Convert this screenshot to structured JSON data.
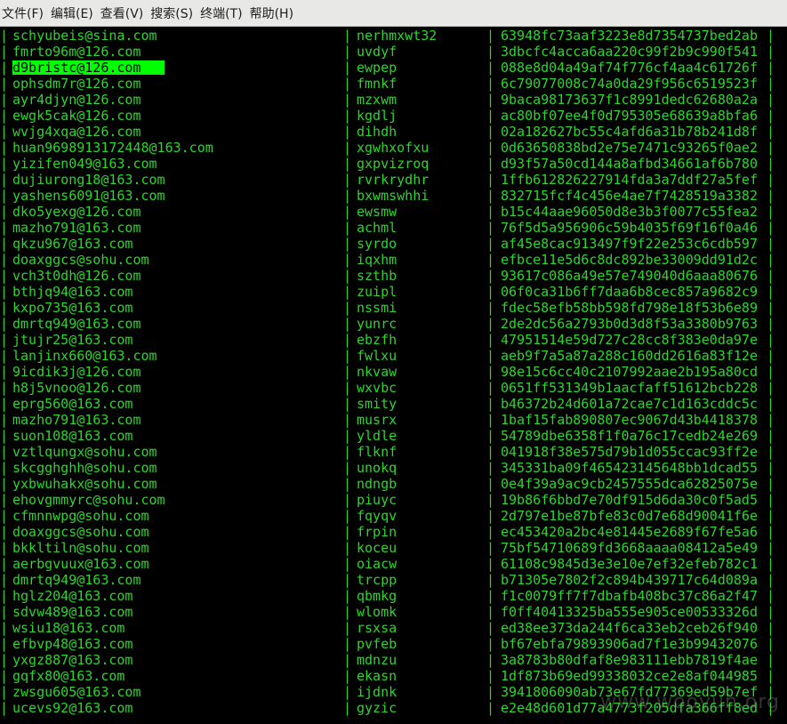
{
  "menubar": {
    "items": [
      "文件(F)",
      "编辑(E)",
      "查看(V)",
      "搜索(S)",
      "终端(T)",
      "帮助(H)"
    ]
  },
  "terminal": {
    "separator": "|",
    "selected_row_index": 2,
    "text_color": "#2ed52e",
    "highlight_color": "#00ff00",
    "rows": [
      {
        "email": "schyubeis@sina.com",
        "username": "nerhmxwt32",
        "hash": "63948fc73aaf3223e8d7354737bed2ab"
      },
      {
        "email": "fmrto96m@126.com",
        "username": "uvdyf",
        "hash": "3dbcfc4acca6aa220c99f2b9c990f541"
      },
      {
        "email": "d9bristc@126.com",
        "username": "ewpep",
        "hash": "088e8d04a49af74f776cf4aa4c61726f"
      },
      {
        "email": "ophsdm7r@126.com",
        "username": "fmnkf",
        "hash": "6c79077008c74a0da29f956c6519523f"
      },
      {
        "email": "ayr4djyn@126.com",
        "username": "mzxwm",
        "hash": "9baca98173637f1c8991dedc62680a2a"
      },
      {
        "email": "ewgk5cak@126.com",
        "username": "kgdlj",
        "hash": "ac80bf07ee4f0d795305e68639a8bfa6"
      },
      {
        "email": "wvjg4xqa@126.com",
        "username": "dihdh",
        "hash": "02a182627bc55c4afd6a31b78b241d8f"
      },
      {
        "email": "huan9698913172448@163.com",
        "username": "xgwhxofxu",
        "hash": "0d63650838bd2e75e7471c93265f0ae2"
      },
      {
        "email": "yizifen049@163.com",
        "username": "gxpvizroq",
        "hash": "d93f57a50cd144a8afbd34661af6b780"
      },
      {
        "email": "dujiurong18@163.com",
        "username": "rvrkrydhr",
        "hash": "1ffb612826227914fda3a7ddf27a5fef"
      },
      {
        "email": "yashens6091@163.com",
        "username": "bxwmswhhi",
        "hash": "832715fcf4c456e4ae7f7428519a3382"
      },
      {
        "email": "dko5yexg@126.com",
        "username": "ewsmw",
        "hash": "b15c44aae96050d8e3b3f0077c55fea2"
      },
      {
        "email": "mazho791@163.com",
        "username": "achml",
        "hash": "76f5d5a956906c59b4035f69f16f0a46"
      },
      {
        "email": "qkzu967@163.com",
        "username": "syrdo",
        "hash": "af45e8cac913497f9f22e253c6cdb597"
      },
      {
        "email": "doaxggcs@sohu.com",
        "username": "iqxhm",
        "hash": "efbce11e5d6c8dc892be33009dd91d2c"
      },
      {
        "email": "vch3t0dh@126.com",
        "username": "szthb",
        "hash": "93617c086a49e57e749040d6aaa80676"
      },
      {
        "email": "bthjq94@163.com",
        "username": "zuipl",
        "hash": "06f0ca31b6ff7daa6b8cec857a9682c9"
      },
      {
        "email": "kxpo735@163.com",
        "username": "nssmi",
        "hash": "fdec58efb58bb598fd798e18f53b6e89"
      },
      {
        "email": "dmrtq949@163.com",
        "username": "yunrc",
        "hash": "2de2dc56a2793b0d3d8f53a3380b9763"
      },
      {
        "email": "jtujr25@163.com",
        "username": "ebzfh",
        "hash": "47951514e59d727c28cc8f383e0da97e"
      },
      {
        "email": "lanjinx660@163.com",
        "username": "fwlxu",
        "hash": "aeb9f7a5a87a288c160dd2616a83f12e"
      },
      {
        "email": "9icdik3j@126.com",
        "username": "nkvaw",
        "hash": "98e15c6cc40c2107992aae2b195a80cd"
      },
      {
        "email": "h8j5vnoo@126.com",
        "username": "wxvbc",
        "hash": "0651ff531349b1aacfaff51612bcb228"
      },
      {
        "email": "eprg560@163.com",
        "username": "smity",
        "hash": "b46372b24d601a72cae7c1d163cddc5c"
      },
      {
        "email": "mazho791@163.com",
        "username": "musrx",
        "hash": "1baf15fab890807ec9067d43b4418378"
      },
      {
        "email": "suon108@163.com",
        "username": "yldle",
        "hash": "54789dbe6358f1f0a76c17cedb24e269"
      },
      {
        "email": "vztlqungx@sohu.com",
        "username": "flknf",
        "hash": "041918f38e575d79b1d055ccac93ff2e"
      },
      {
        "email": "skcgghghh@sohu.com",
        "username": "unokq",
        "hash": "345331ba09f465423145648bb1dcad55"
      },
      {
        "email": "yxbwuhakx@sohu.com",
        "username": "ndngb",
        "hash": "0e4f39a9ac9cb2457555dca62825075e"
      },
      {
        "email": "ehovgmmyrc@sohu.com",
        "username": "piuyc",
        "hash": "19b86f6bbd7e70df915d6da30c0f5ad5"
      },
      {
        "email": "cfmnnwpg@sohu.com",
        "username": "fqyqv",
        "hash": "2d797e1be87bfe83c0d7e68d90041f6e"
      },
      {
        "email": "doaxggcs@sohu.com",
        "username": "frpin",
        "hash": "ec453420a2bc4e81445e2689f67fe5a6"
      },
      {
        "email": "bkkltiln@sohu.com",
        "username": "koceu",
        "hash": "75bf54710689fd3668aaaa08412a5e49"
      },
      {
        "email": "aerbgvuux@163.com",
        "username": "oiacw",
        "hash": "61108c9845d3e3e10e7ef32efeb782c1"
      },
      {
        "email": "dmrtq949@163.com",
        "username": "trcpp",
        "hash": "b71305e7802f2c894b439717c64d089a"
      },
      {
        "email": "hglz204@163.com",
        "username": "qbmkg",
        "hash": "f1c0079ff7f7dbafb408bc37c86a2f47"
      },
      {
        "email": "sdvw489@163.com",
        "username": "wlomk",
        "hash": "f0ff40413325ba555e905ce00533326d"
      },
      {
        "email": "wsiu18@163.com",
        "username": "rsxsa",
        "hash": "ed38ee373da244f6ca33eb2ceb26f940"
      },
      {
        "email": "efbvp48@163.com",
        "username": "pvfeb",
        "hash": "bf67ebfa79893906ad7f1e3b99432076"
      },
      {
        "email": "yxgz887@163.com",
        "username": "mdnzu",
        "hash": "3a8783b80dfaf8e983111ebb7819f4ae"
      },
      {
        "email": "gqfx80@163.com",
        "username": "ekasn",
        "hash": "1df873b69ed99338032ce2e8af044985"
      },
      {
        "email": "zwsgu605@163.com",
        "username": "ijdnk",
        "hash": "3941806090ab73e67fd77369ed59b7ef"
      },
      {
        "email": "ucevs92@163.com",
        "username": "gyzic",
        "hash": "e2e48d601d77a4773f205dfa366ff8ed"
      }
    ]
  },
  "watermark": {
    "text": "www.wooyun.org"
  }
}
